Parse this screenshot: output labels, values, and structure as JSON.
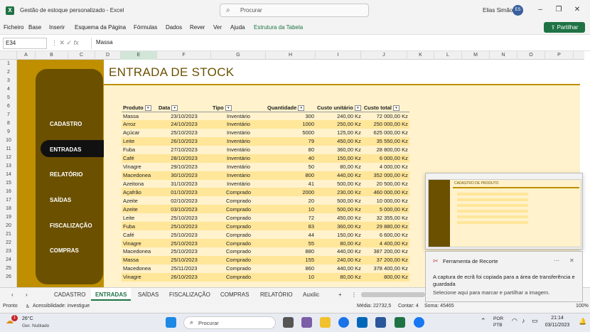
{
  "app": {
    "title": "Gestão de estoque personalizado - Excel",
    "search_placeholder": "Procurar",
    "user": "Elias Simão",
    "avatar_initials": "ES",
    "accent": "#1f7244"
  },
  "ribbon": {
    "tabs": [
      "Ficheiro",
      "Base",
      "Inserir",
      "Esquema da Página",
      "Fórmulas",
      "Dados",
      "Rever",
      "Ver",
      "Ajuda",
      "Estrutura da Tabela"
    ],
    "share": "Partilhar"
  },
  "formula": {
    "namebox": "E34",
    "content": "Massa"
  },
  "columns": [
    "A",
    "B",
    "C",
    "D",
    "E",
    "F",
    "G",
    "H",
    "I",
    "J",
    "K",
    "L",
    "M",
    "N",
    "O",
    "P"
  ],
  "rows": [
    "1",
    "2",
    "3",
    "4",
    "5",
    "6",
    "7",
    "8",
    "9",
    "10",
    "11",
    "12",
    "13",
    "14",
    "15",
    "16",
    "17",
    "18",
    "19",
    "20",
    "21",
    "22",
    "23",
    "24",
    "25",
    "26"
  ],
  "nav": {
    "items": [
      "CADASTRO",
      "ENTRADAS",
      "RELATÓRIO",
      "SAÍDAS",
      "FISCALIZAÇÃO",
      "COMPRAS"
    ],
    "active": "ENTRADAS"
  },
  "sheet": {
    "title": "ENTRADA DE STOCK",
    "headers": [
      "Produto",
      "Data",
      "Tipo",
      "Quantidade",
      "Custo unitário",
      "Custo total"
    ],
    "rows": [
      [
        "Massa",
        "23/10/2023",
        "Inventário",
        "300",
        "240,00 Kz",
        "72 000,00 Kz"
      ],
      [
        "Arroz",
        "24/10/2023",
        "Inventário",
        "1000",
        "250,00 Kz",
        "250 000,00 Kz"
      ],
      [
        "Açúcar",
        "25/10/2023",
        "Inventário",
        "5000",
        "125,00 Kz",
        "625 000,00 Kz"
      ],
      [
        "Leite",
        "26/10/2023",
        "Inventário",
        "79",
        "450,00 Kz",
        "35 550,00 Kz"
      ],
      [
        "Fuba",
        "27/10/2023",
        "Inventário",
        "80",
        "360,00 Kz",
        "28 800,00 Kz"
      ],
      [
        "Café",
        "28/10/2023",
        "Inventário",
        "40",
        "150,00 Kz",
        "6 000,00 Kz"
      ],
      [
        "Vinagre",
        "29/10/2023",
        "Inventário",
        "50",
        "80,00 Kz",
        "4 000,00 Kz"
      ],
      [
        "Macedonea",
        "30/10/2023",
        "Inventário",
        "800",
        "440,00 Kz",
        "352 000,00 Kz"
      ],
      [
        "Azeitona",
        "31/10/2023",
        "Inventário",
        "41",
        "500,00 Kz",
        "20 500,00 Kz"
      ],
      [
        "Açafrão",
        "01/10/2023",
        "Comprado",
        "2000",
        "230,00 Kz",
        "460 000,00 Kz"
      ],
      [
        "Azeite",
        "02/10/2023",
        "Comprado",
        "20",
        "500,00 Kz",
        "10 000,00 Kz"
      ],
      [
        "Azeite",
        "03/10/2023",
        "Comprado",
        "10",
        "500,00 Kz",
        "5 000,00 Kz"
      ],
      [
        "Leite",
        "25/10/2023",
        "Comprado",
        "72",
        "450,00 Kz",
        "32 355,00 Kz"
      ],
      [
        "Fuba",
        "25/10/2023",
        "Comprado",
        "83",
        "360,00 Kz",
        "29 880,00 Kz"
      ],
      [
        "Café",
        "25/10/2023",
        "Comprado",
        "44",
        "150,00 Kz",
        "6 600,00 Kz"
      ],
      [
        "Vinagre",
        "25/10/2023",
        "Comprado",
        "55",
        "80,00 Kz",
        "4 400,00 Kz"
      ],
      [
        "Macedonea",
        "25/10/2023",
        "Comprado",
        "880",
        "440,00 Kz",
        "387 200,00 Kz"
      ],
      [
        "Massa",
        "25/10/2023",
        "Comprado",
        "155",
        "240,00 Kz",
        "37 200,00 Kz"
      ],
      [
        "Macedonea",
        "25/11/2023",
        "Comprado",
        "860",
        "440,00 Kz",
        "378 400,00 Kz"
      ],
      [
        "Vinagre",
        "26/10/2023",
        "Comprado",
        "10",
        "80,00 Kz",
        "800,00 Kz"
      ]
    ]
  },
  "tabs": {
    "items": [
      "CADASTRO",
      "ENTRADAS",
      "SAÍDAS",
      "FISCALIZAÇÃO",
      "COMPRAS",
      "RELATÓRIO",
      "Auxilic"
    ],
    "active": "ENTRADAS"
  },
  "status": {
    "ready": "Pronto",
    "accessibility": "Acessibilidade: investigue",
    "average": "Média: 22732,5",
    "count": "Contar: 4",
    "sum": "Soma: 45465",
    "zoom": "100%"
  },
  "popup": {
    "thumb_title": "CADASTRO DE PRODUTO",
    "toast_title": "Ferramenta de Recorte",
    "toast_body": "A captura de ecrã foi copiada para a área de transferência e guardada",
    "toast_hint": "Selecione aqui para marcar e partilhar a imagem."
  },
  "taskbar": {
    "temp": "26°C",
    "weather": "Ger. Nublado",
    "search": "Procurar",
    "lang1": "POR",
    "lang2": "PTB",
    "time": "21:14",
    "date": "03/11/2023",
    "badge": "1"
  }
}
